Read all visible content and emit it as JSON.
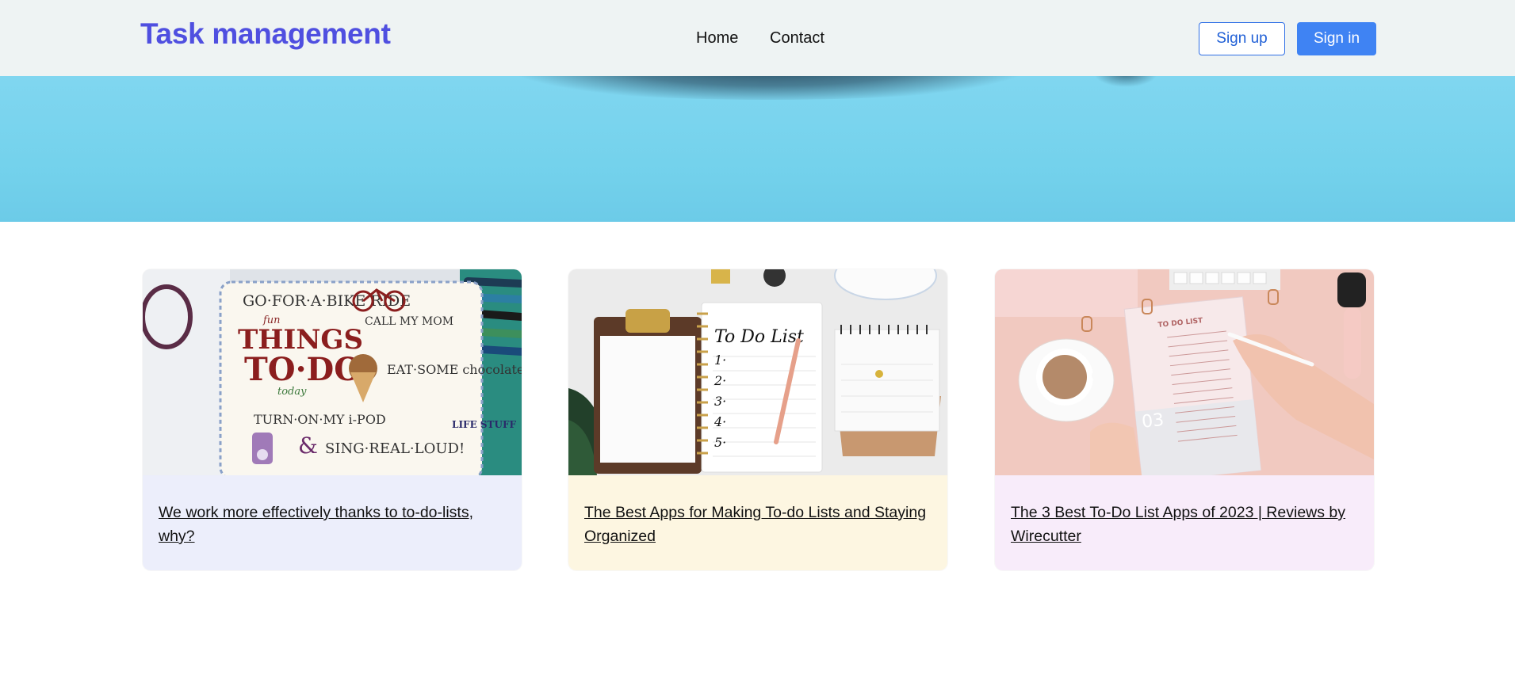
{
  "header": {
    "brand": "Task management",
    "nav": [
      {
        "label": "Home"
      },
      {
        "label": "Contact"
      }
    ],
    "signup_label": "Sign up",
    "signin_label": "Sign in"
  },
  "colors": {
    "brand": "#4f4fe0",
    "signin_bg": "#3f83f3",
    "signup_border": "#2f6fe6",
    "header_bg": "#eef3f3",
    "hero_bg": "#76d3ed"
  },
  "cards": [
    {
      "title": "We work more effectively thanks to to-do-lists, why?",
      "image_text": [
        "GO·FOR·A·BIKE RIDE",
        "fun",
        "THINGS",
        "TO·DO",
        "today",
        "CALL MY MOM",
        "EAT·SOME chocolate ICE·CREAM",
        "TURN·ON·MY i-POD",
        "&",
        "SING·REAL·LOUD!",
        "LIFE STUFF"
      ]
    },
    {
      "title": "The Best Apps for Making To-do Lists and Staying Organized",
      "image_text": [
        "To Do List",
        "1·",
        "2·",
        "3·",
        "4·",
        "5·"
      ]
    },
    {
      "title": "The 3 Best To-Do List Apps of 2023 | Reviews by Wirecutter",
      "image_text": [
        "TO DO LIST",
        "03"
      ]
    }
  ]
}
